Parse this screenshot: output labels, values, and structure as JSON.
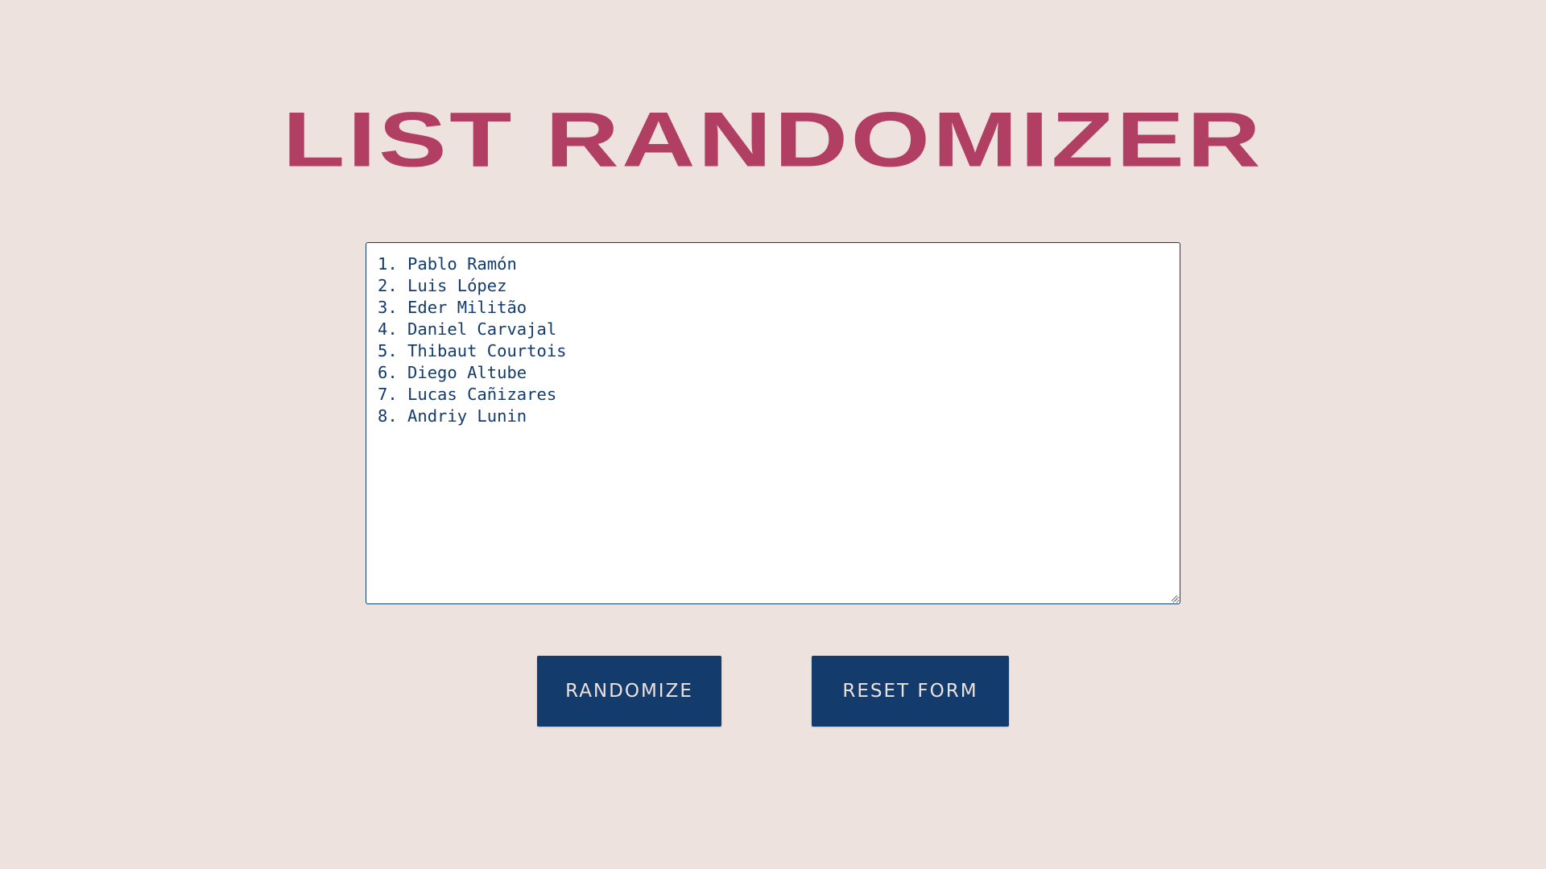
{
  "app": {
    "title": "LIST RANDOMIZER"
  },
  "list": {
    "lines": [
      "1. Pablo Ramón",
      "2. Luis López",
      "3. Eder Militão",
      "4. Daniel Carvajal",
      "5. Thibaut Courtois",
      "6. Diego Altube",
      "7. Lucas Cañizares",
      "8. Andriy Lunin"
    ]
  },
  "actions": {
    "randomize_label": "RANDOMIZE",
    "reset_label": "RESET FORM"
  },
  "colors": {
    "background": "#ede2de",
    "title": "#b03f63",
    "primary": "#133b6b",
    "button_text": "#ede2de"
  },
  "icons": {
    "resize": "resize-grip-icon"
  }
}
